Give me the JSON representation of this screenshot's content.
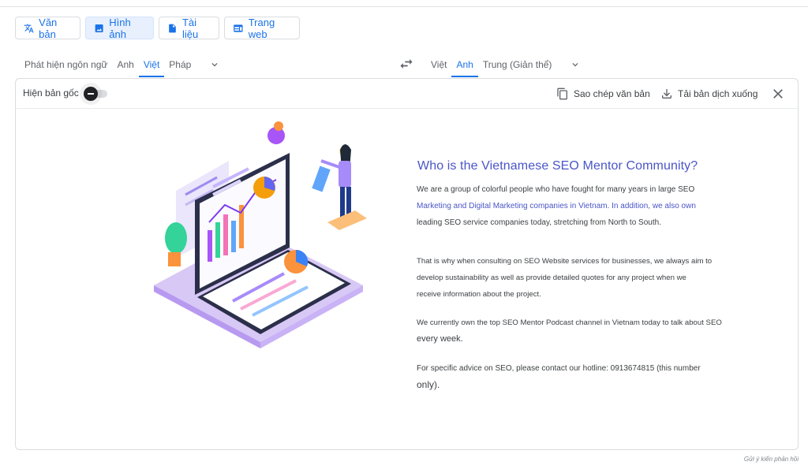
{
  "modes": [
    {
      "label": "Văn bản",
      "icon": "translate-icon"
    },
    {
      "label": "Hình ảnh",
      "icon": "image-icon",
      "active": true
    },
    {
      "label": "Tài liệu",
      "icon": "document-icon"
    },
    {
      "label": "Trang web",
      "icon": "web-icon"
    }
  ],
  "source_langs": [
    "Phát hiện ngôn ngữ",
    "Anh",
    "Việt",
    "Pháp"
  ],
  "source_active": "Việt",
  "target_langs": [
    "Việt",
    "Anh",
    "Trung (Giản thể)"
  ],
  "target_active": "Anh",
  "panel": {
    "show_original": "Hiện bản gốc",
    "copy_text": "Sao chép văn bản",
    "download": "Tải bản dịch xuống"
  },
  "translated": {
    "title": "Who is the Vietnamese SEO Mentor Community?",
    "p1_line1": "We are a group of colorful people who have fought for many years in large SEO",
    "p1_line2": "Marketing and Digital Marketing companies in Vietnam. In addition, we also own",
    "p1_line3": "leading SEO service companies today, stretching from North to South.",
    "p2_line1": "That is why when consulting on SEO Website services for businesses, we always aim to",
    "p2_line2": "develop sustainability as well as provide detailed quotes for any project when we",
    "p2_line3": "receive information about the project.",
    "p3_line1": "We currently own the top SEO Mentor Podcast channel in Vietnam today to talk about SEO",
    "p3_line2": "every week.",
    "p4_line1": "For specific advice on SEO, please contact our hotline: 0913674815 (this number",
    "p4_line2": "only)."
  },
  "feedback": "Gửi ý kiến phản hồi",
  "colors": {
    "accent": "#1a73e8",
    "title": "#4a55c8",
    "illustration_purple": "#a78bfa"
  }
}
